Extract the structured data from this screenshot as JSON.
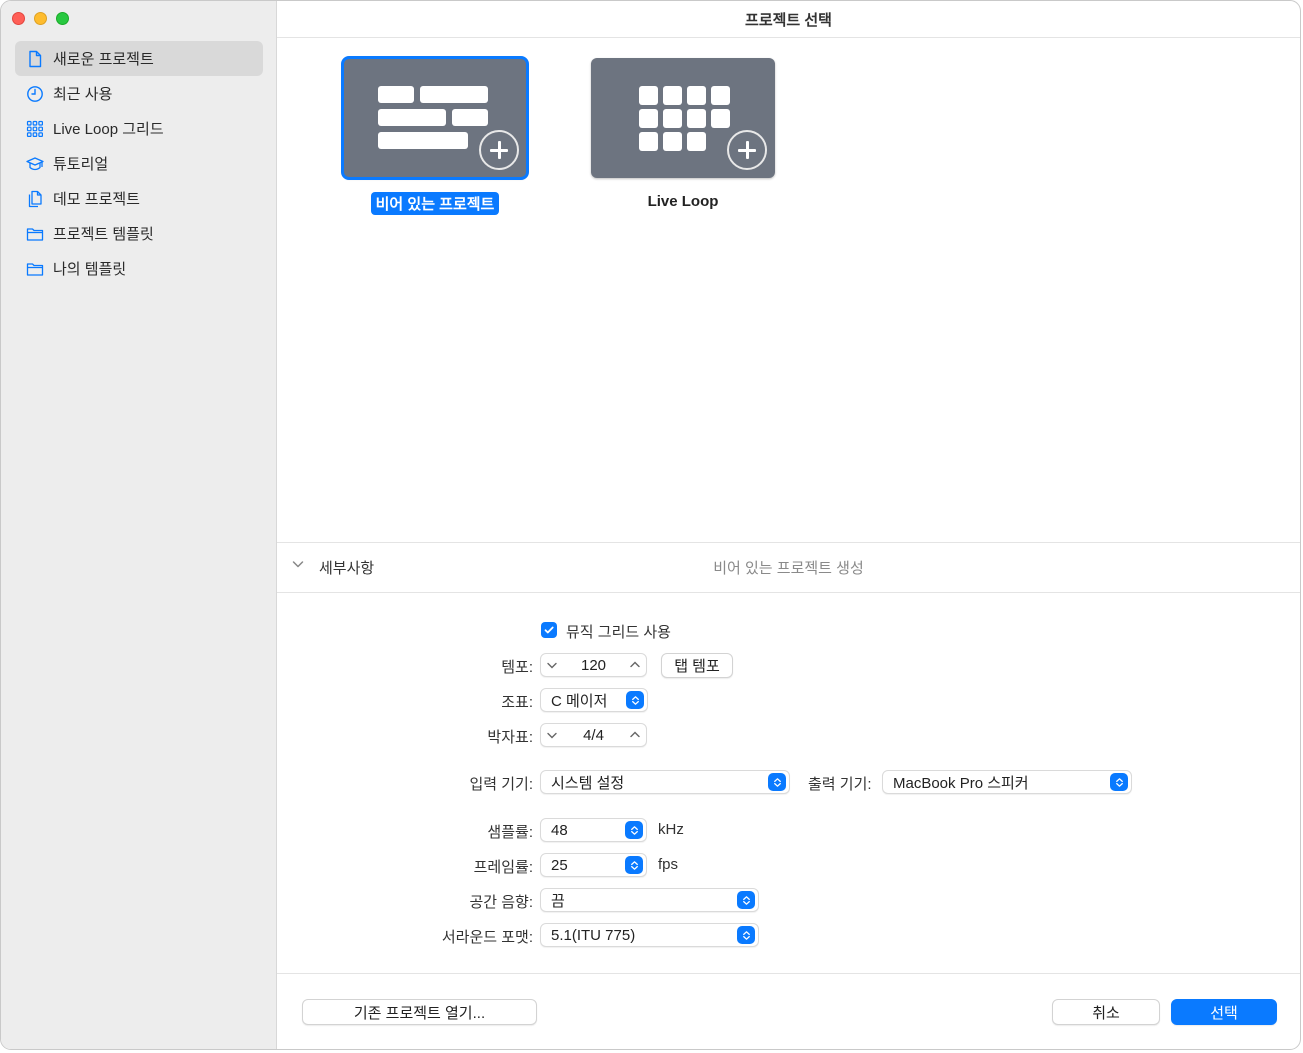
{
  "window": {
    "title": "프로젝트 선택"
  },
  "sidebar": {
    "items": [
      {
        "label": "새로운 프로젝트",
        "icon": "document-icon",
        "selected": true
      },
      {
        "label": "최근 사용",
        "icon": "clock-icon",
        "selected": false
      },
      {
        "label": "Live Loop 그리드",
        "icon": "grid-icon",
        "selected": false
      },
      {
        "label": "튜토리얼",
        "icon": "graduation-cap-icon",
        "selected": false
      },
      {
        "label": "데모 프로젝트",
        "icon": "documents-icon",
        "selected": false
      },
      {
        "label": "프로젝트 템플릿",
        "icon": "folder-icon",
        "selected": false
      },
      {
        "label": "나의 템플릿",
        "icon": "folder-icon",
        "selected": false
      }
    ]
  },
  "gallery": {
    "tiles": [
      {
        "label": "비어 있는 프로젝트",
        "icon": "empty-project-icon",
        "selected": true
      },
      {
        "label": "Live Loop",
        "icon": "live-loop-icon",
        "selected": false
      }
    ]
  },
  "details": {
    "label": "세부사항",
    "subtitle": "비어 있는 프로젝트 생성"
  },
  "form": {
    "music_grid": {
      "label": "뮤직 그리드 사용",
      "checked": true
    },
    "tempo": {
      "label": "템포:",
      "value": "120",
      "tap_label": "탭 템포"
    },
    "key": {
      "label": "조표:",
      "value": "C 메이저"
    },
    "time_signature": {
      "label": "박자표:",
      "value": "4/4"
    },
    "input_device": {
      "label": "입력 기기:",
      "value": "시스템 설정"
    },
    "output_device": {
      "label": "출력 기기:",
      "value": "MacBook Pro 스피커"
    },
    "sample_rate": {
      "label": "샘플률:",
      "value": "48",
      "unit": "kHz"
    },
    "frame_rate": {
      "label": "프레임률:",
      "value": "25",
      "unit": "fps"
    },
    "spatial_audio": {
      "label": "공간 음향:",
      "value": "끔"
    },
    "surround_format": {
      "label": "서라운드 포맷:",
      "value": "5.1(ITU 775)"
    }
  },
  "footer": {
    "open_existing": "기존 프로젝트 열기...",
    "cancel": "취소",
    "choose": "선택"
  },
  "colors": {
    "accent": "#0a7aff",
    "thumb": "#6d7480",
    "sidebar": "#ededed"
  }
}
